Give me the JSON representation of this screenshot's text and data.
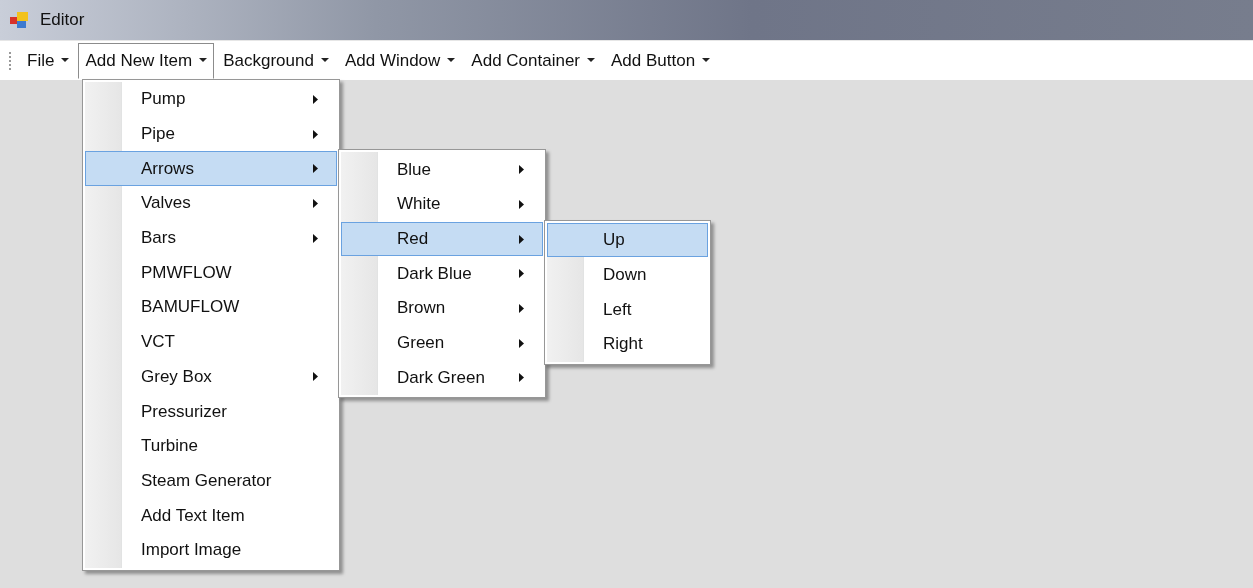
{
  "window": {
    "title": "Editor"
  },
  "menu_bar": {
    "items": [
      {
        "label": "File",
        "selected": false
      },
      {
        "label": "Add New Item",
        "selected": true,
        "children": [
          {
            "label": "Pump",
            "has_submenu": true,
            "selected": false
          },
          {
            "label": "Pipe",
            "has_submenu": true,
            "selected": false
          },
          {
            "label": "Arrows",
            "has_submenu": true,
            "selected": true,
            "children": [
              {
                "label": "Blue",
                "has_submenu": true,
                "selected": false
              },
              {
                "label": "White",
                "has_submenu": true,
                "selected": false
              },
              {
                "label": "Red",
                "has_submenu": true,
                "selected": true,
                "children": [
                  {
                    "label": "Up",
                    "has_submenu": false,
                    "selected": true
                  },
                  {
                    "label": "Down",
                    "has_submenu": false,
                    "selected": false
                  },
                  {
                    "label": "Left",
                    "has_submenu": false,
                    "selected": false
                  },
                  {
                    "label": "Right",
                    "has_submenu": false,
                    "selected": false
                  }
                ]
              },
              {
                "label": "Dark Blue",
                "has_submenu": true,
                "selected": false
              },
              {
                "label": "Brown",
                "has_submenu": true,
                "selected": false
              },
              {
                "label": "Green",
                "has_submenu": true,
                "selected": false
              },
              {
                "label": "Dark Green",
                "has_submenu": true,
                "selected": false
              }
            ]
          },
          {
            "label": "Valves",
            "has_submenu": true,
            "selected": false
          },
          {
            "label": "Bars",
            "has_submenu": true,
            "selected": false
          },
          {
            "label": "PMWFLOW",
            "has_submenu": false,
            "selected": false
          },
          {
            "label": "BAMUFLOW",
            "has_submenu": false,
            "selected": false
          },
          {
            "label": "VCT",
            "has_submenu": false,
            "selected": false
          },
          {
            "label": "Grey Box",
            "has_submenu": true,
            "selected": false
          },
          {
            "label": "Pressurizer",
            "has_submenu": false,
            "selected": false
          },
          {
            "label": "Turbine",
            "has_submenu": false,
            "selected": false
          },
          {
            "label": "Steam Generator",
            "has_submenu": false,
            "selected": false
          },
          {
            "label": "Add Text Item",
            "has_submenu": false,
            "selected": false
          },
          {
            "label": "Import Image",
            "has_submenu": false,
            "selected": false
          }
        ]
      },
      {
        "label": "Background",
        "selected": false
      },
      {
        "label": "Add Window",
        "selected": false
      },
      {
        "label": "Add Container",
        "selected": false
      },
      {
        "label": "Add Button",
        "selected": false
      }
    ]
  }
}
